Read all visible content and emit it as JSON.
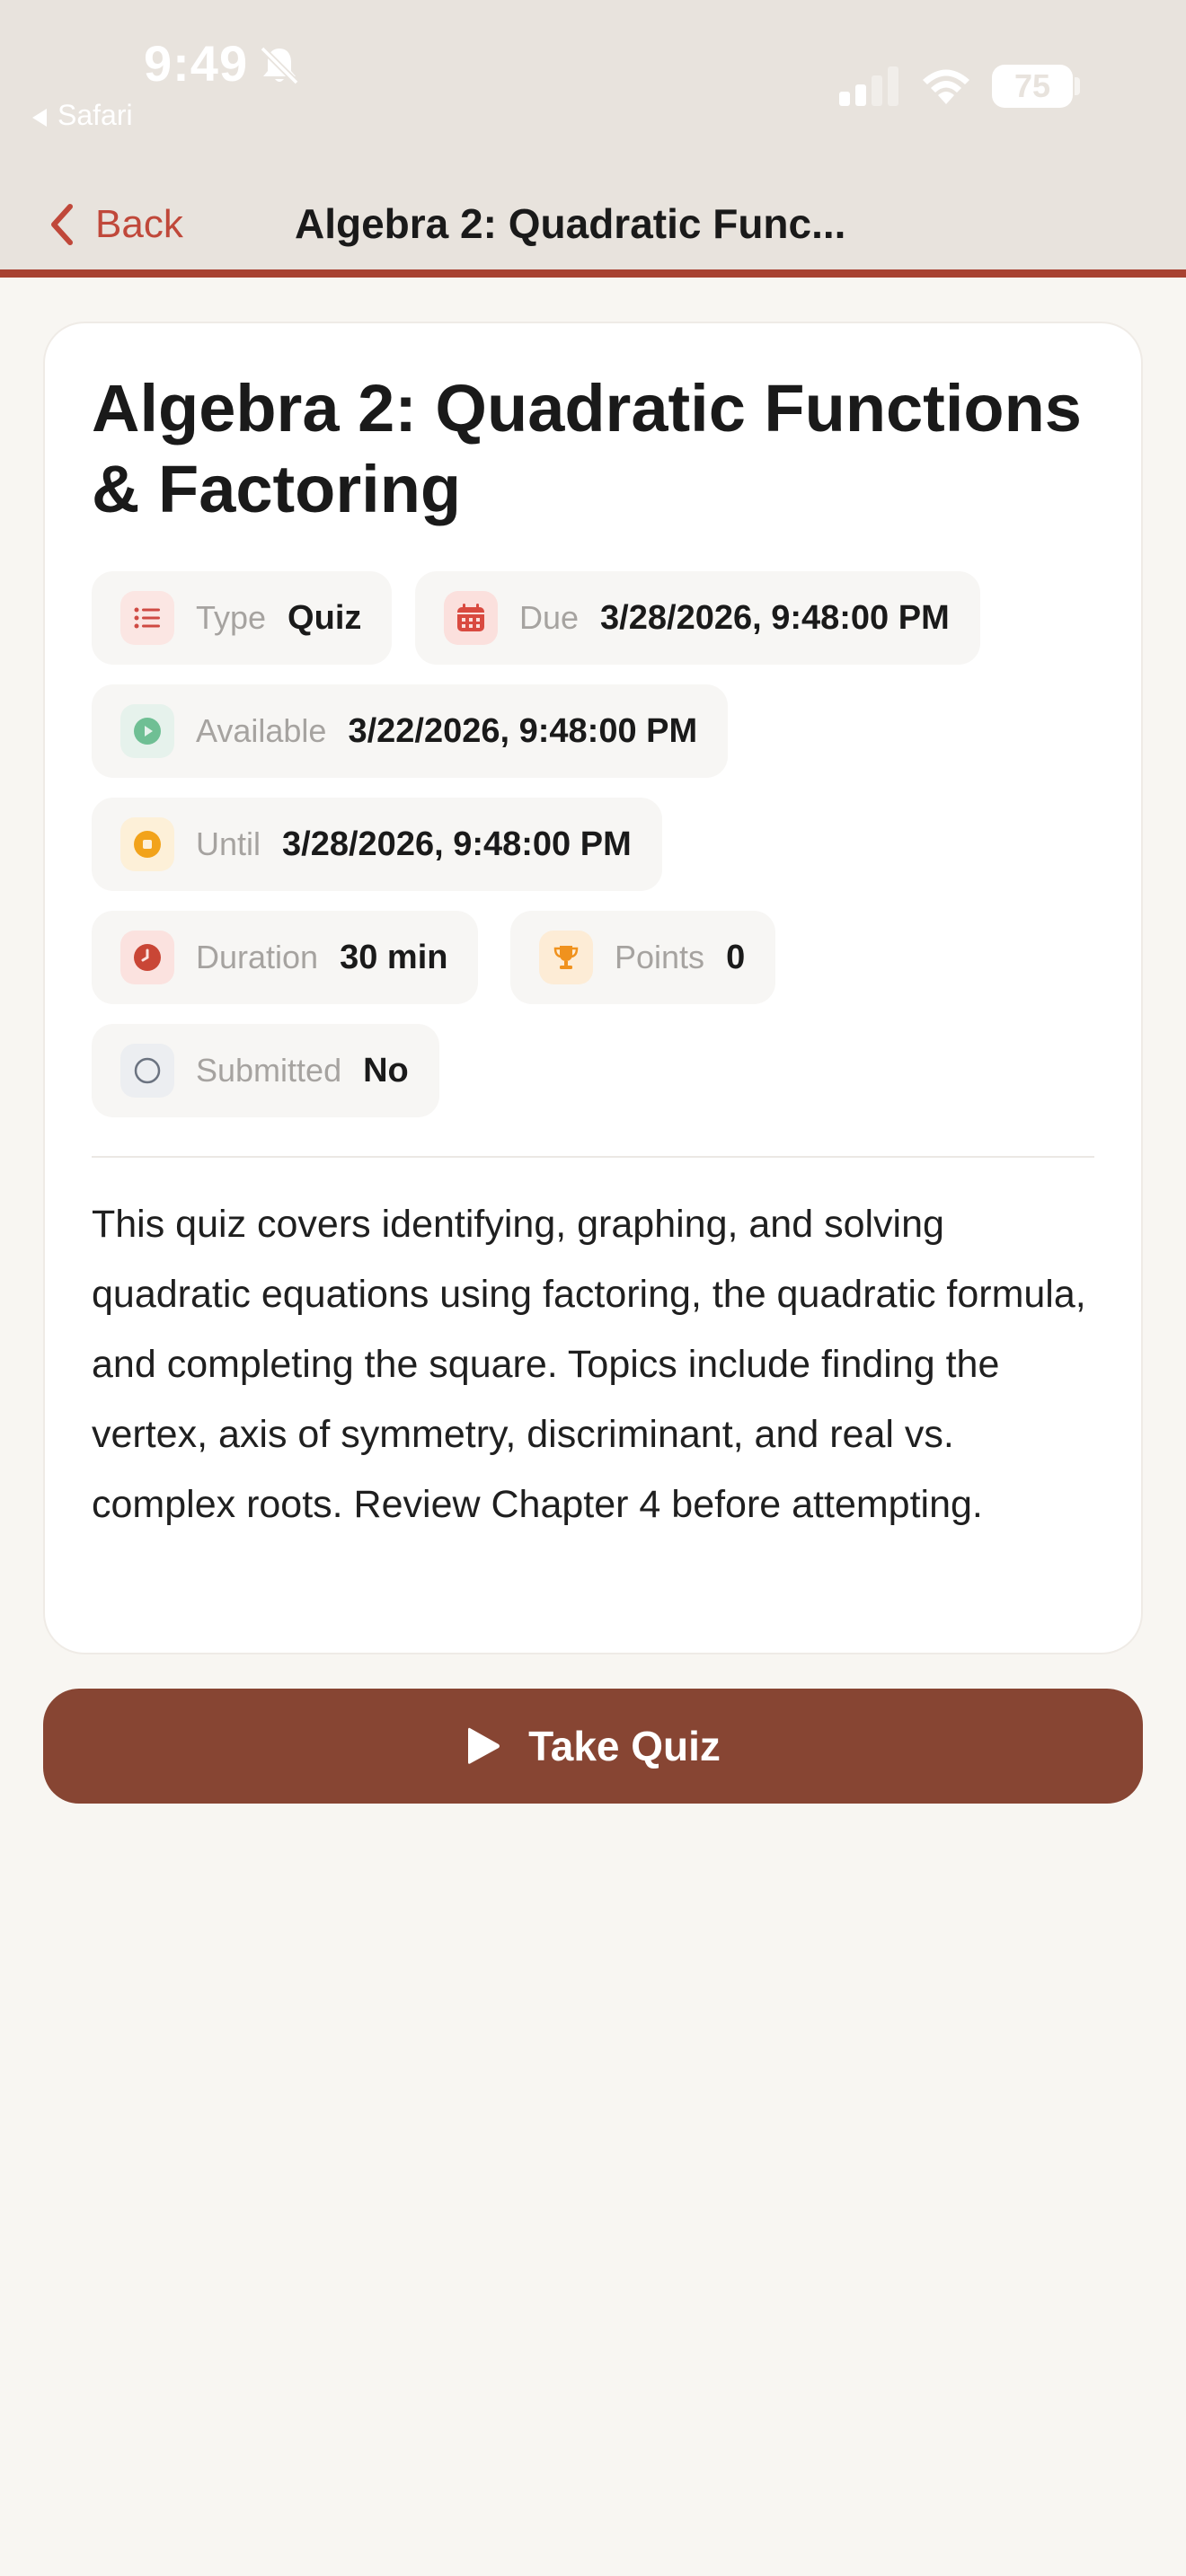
{
  "status_bar": {
    "time": "9:49",
    "back_app": "Safari",
    "battery": "75"
  },
  "nav": {
    "back_label": "Back",
    "title": "Algebra 2: Quadratic Func...",
    "accent_color": "#a84232"
  },
  "quiz": {
    "title": "Algebra 2: Quadratic Functions & Factoring",
    "meta": {
      "type": {
        "label": "Type",
        "value": "Quiz",
        "icon": "list-icon"
      },
      "due": {
        "label": "Due",
        "value": "3/28/2026, 9:48:00 PM",
        "icon": "calendar-icon"
      },
      "available": {
        "label": "Available",
        "value": "3/22/2026, 9:48:00 PM",
        "icon": "play-circle-icon"
      },
      "until": {
        "label": "Until",
        "value": "3/28/2026, 9:48:00 PM",
        "icon": "stop-circle-icon"
      },
      "duration": {
        "label": "Duration",
        "value": "30 min",
        "icon": "clock-icon"
      },
      "points": {
        "label": "Points",
        "value": "0",
        "icon": "trophy-icon"
      },
      "submitted": {
        "label": "Submitted",
        "value": "No",
        "icon": "circle-icon"
      }
    },
    "description": "This quiz covers identifying, graphing, and solving quadratic equations using factoring, the quadratic formula, and completing the square. Topics include finding the vertex, axis of symmetry, discriminant, and real vs. complex roots. Review Chapter 4 before attempting."
  },
  "action": {
    "label": "Take Quiz",
    "color": "#874533",
    "icon": "play-icon"
  }
}
